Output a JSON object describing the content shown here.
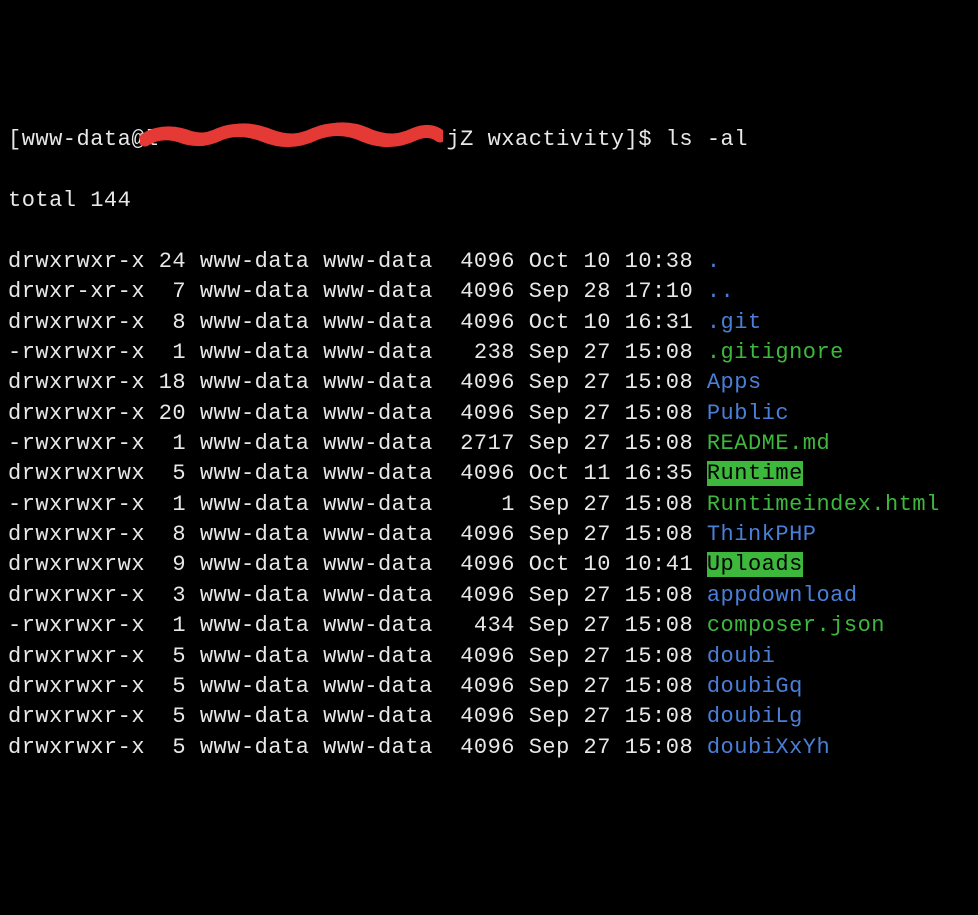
{
  "prompt": {
    "user": "www-data",
    "at": "@",
    "host_masked": "l",
    "host_suffix": "jZ",
    "dir": "wxactivity",
    "bracket_close": "]$",
    "command": "ls -al"
  },
  "total_label": "total",
  "total_value": "144",
  "rows": [
    {
      "perm": "drwxrwxr-x",
      "links": "24",
      "user": "www-data",
      "group": "www-data",
      "size": "4096",
      "month": "Oct",
      "day": "10",
      "time": "10:38",
      "name": ".",
      "cls": "blue"
    },
    {
      "perm": "drwxr-xr-x",
      "links": " 7",
      "user": "www-data",
      "group": "www-data",
      "size": "4096",
      "month": "Sep",
      "day": "28",
      "time": "17:10",
      "name": "..",
      "cls": "blue"
    },
    {
      "perm": "drwxrwxr-x",
      "links": " 8",
      "user": "www-data",
      "group": "www-data",
      "size": "4096",
      "month": "Oct",
      "day": "10",
      "time": "16:31",
      "name": ".git",
      "cls": "blue"
    },
    {
      "perm": "-rwxrwxr-x",
      "links": " 1",
      "user": "www-data",
      "group": "www-data",
      "size": " 238",
      "month": "Sep",
      "day": "27",
      "time": "15:08",
      "name": ".gitignore",
      "cls": "green"
    },
    {
      "perm": "drwxrwxr-x",
      "links": "18",
      "user": "www-data",
      "group": "www-data",
      "size": "4096",
      "month": "Sep",
      "day": "27",
      "time": "15:08",
      "name": "Apps",
      "cls": "blue"
    },
    {
      "perm": "drwxrwxr-x",
      "links": "20",
      "user": "www-data",
      "group": "www-data",
      "size": "4096",
      "month": "Sep",
      "day": "27",
      "time": "15:08",
      "name": "Public",
      "cls": "blue"
    },
    {
      "perm": "-rwxrwxr-x",
      "links": " 1",
      "user": "www-data",
      "group": "www-data",
      "size": "2717",
      "month": "Sep",
      "day": "27",
      "time": "15:08",
      "name": "README.md",
      "cls": "green"
    },
    {
      "perm": "drwxrwxrwx",
      "links": " 5",
      "user": "www-data",
      "group": "www-data",
      "size": "4096",
      "month": "Oct",
      "day": "11",
      "time": "16:35",
      "name": "Runtime",
      "cls": "highlight-green"
    },
    {
      "perm": "-rwxrwxr-x",
      "links": " 1",
      "user": "www-data",
      "group": "www-data",
      "size": "   1",
      "month": "Sep",
      "day": "27",
      "time": "15:08",
      "name": "Runtimeindex.html",
      "cls": "green"
    },
    {
      "perm": "drwxrwxr-x",
      "links": " 8",
      "user": "www-data",
      "group": "www-data",
      "size": "4096",
      "month": "Sep",
      "day": "27",
      "time": "15:08",
      "name": "ThinkPHP",
      "cls": "blue"
    },
    {
      "perm": "drwxrwxrwx",
      "links": " 9",
      "user": "www-data",
      "group": "www-data",
      "size": "4096",
      "month": "Oct",
      "day": "10",
      "time": "10:41",
      "name": "Uploads",
      "cls": "highlight-green"
    },
    {
      "perm": "drwxrwxr-x",
      "links": " 3",
      "user": "www-data",
      "group": "www-data",
      "size": "4096",
      "month": "Sep",
      "day": "27",
      "time": "15:08",
      "name": "appdownload",
      "cls": "blue"
    },
    {
      "perm": "-rwxrwxr-x",
      "links": " 1",
      "user": "www-data",
      "group": "www-data",
      "size": " 434",
      "month": "Sep",
      "day": "27",
      "time": "15:08",
      "name": "composer.json",
      "cls": "green"
    },
    {
      "perm": "drwxrwxr-x",
      "links": " 5",
      "user": "www-data",
      "group": "www-data",
      "size": "4096",
      "month": "Sep",
      "day": "27",
      "time": "15:08",
      "name": "doubi",
      "cls": "blue"
    },
    {
      "perm": "drwxrwxr-x",
      "links": " 5",
      "user": "www-data",
      "group": "www-data",
      "size": "4096",
      "month": "Sep",
      "day": "27",
      "time": "15:08",
      "name": "doubiGq",
      "cls": "blue"
    },
    {
      "perm": "drwxrwxr-x",
      "links": " 5",
      "user": "www-data",
      "group": "www-data",
      "size": "4096",
      "month": "Sep",
      "day": "27",
      "time": "15:08",
      "name": "doubiLg",
      "cls": "blue"
    },
    {
      "perm": "drwxrwxr-x",
      "links": " 5",
      "user": "www-data",
      "group": "www-data",
      "size": "4096",
      "month": "Sep",
      "day": "27",
      "time": "15:08",
      "name": "doubiXxYh",
      "cls": "blue"
    }
  ]
}
